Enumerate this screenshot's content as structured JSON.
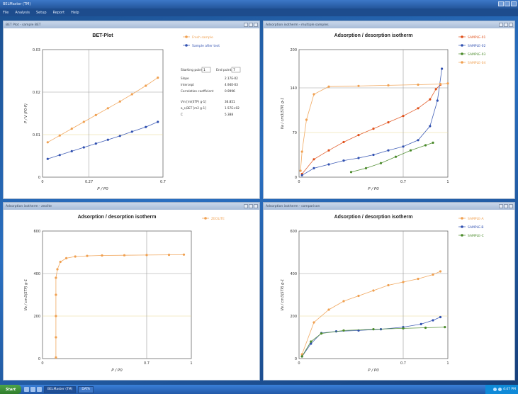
{
  "app": {
    "title": "BELMaster (TM)",
    "menu": [
      "File",
      "Analysis",
      "Setup",
      "Report",
      "Help"
    ]
  },
  "colors": {
    "orange": "#f0a050",
    "red": "#e0501a",
    "blue": "#3050b0",
    "green": "#4a8a2a",
    "lightgreen": "#8ab040",
    "ref_line": "#e8d890"
  },
  "windows": [
    {
      "id": "bet",
      "title": "BET Plot - sample BET",
      "chart_data": {
        "type": "line",
        "title": "BET-Plot",
        "xlabel": "P / P0",
        "ylabel": "P / V (P0-P)",
        "xlim": [
          0,
          0.7
        ],
        "ylim": [
          0,
          0.03
        ],
        "xticks": [
          "0",
          "0.27",
          "0.7"
        ],
        "yticks": [
          "0",
          "0.01",
          "0.02",
          "0.03"
        ],
        "series": [
          {
            "name": "Fresh sample",
            "color": "orange",
            "x": [
              0.03,
              0.1,
              0.17,
              0.24,
              0.31,
              0.38,
              0.45,
              0.52,
              0.6,
              0.67
            ],
            "y": [
              0.0082,
              0.0098,
              0.0114,
              0.013,
              0.0146,
              0.0162,
              0.0178,
              0.0195,
              0.0215,
              0.0234
            ]
          },
          {
            "name": "Sample after test",
            "color": "blue",
            "x": [
              0.03,
              0.1,
              0.17,
              0.24,
              0.31,
              0.38,
              0.45,
              0.52,
              0.6,
              0.67
            ],
            "y": [
              0.0043,
              0.0052,
              0.0061,
              0.007,
              0.0079,
              0.0088,
              0.0097,
              0.0107,
              0.0118,
              0.013
            ]
          }
        ]
      },
      "fit_panel": {
        "start_label": "Starting point",
        "end_label": "End point",
        "start_value": "1",
        "end_value": "7",
        "rows": [
          {
            "label": "Slope",
            "value": "2.17E-02"
          },
          {
            "label": "Intercept",
            "value": "4.94E-03"
          },
          {
            "label": "Correlation coefficient",
            "value": "0.9996"
          },
          {
            "label": "Vm [ml(STP) g-1]",
            "value": "36.851"
          },
          {
            "label": "a_s,BET [m2 g-1]",
            "value": "1.57E+02"
          },
          {
            "label": "C",
            "value": "5.388"
          }
        ]
      }
    },
    {
      "id": "iso1",
      "title": "Adsorption isotherm - multiple samples",
      "chart_data": {
        "type": "scatter",
        "title": "Adsorption / desorption isotherm",
        "xlabel": "P / P0",
        "ylabel": "Va / cm3(STP) g-1",
        "xlim": [
          0,
          1
        ],
        "ylim": [
          0,
          200
        ],
        "xticks": [
          "0",
          "0.7",
          "1"
        ],
        "yticks": [
          "0",
          "70",
          "140",
          "200"
        ],
        "series": [
          {
            "name": "SAMPLE-01",
            "color": "red",
            "x": [
              0.02,
              0.1,
              0.2,
              0.3,
              0.4,
              0.5,
              0.6,
              0.7,
              0.8,
              0.88,
              0.92,
              0.95
            ],
            "y": [
              5,
              28,
              42,
              55,
              66,
              76,
              86,
              96,
              108,
              122,
              138,
              145
            ]
          },
          {
            "name": "SAMPLE-02",
            "color": "blue",
            "x": [
              0.02,
              0.1,
              0.2,
              0.3,
              0.4,
              0.5,
              0.6,
              0.7,
              0.8,
              0.88,
              0.93,
              0.96
            ],
            "y": [
              3,
              14,
              20,
              26,
              30,
              35,
              42,
              48,
              58,
              80,
              120,
              170
            ]
          },
          {
            "name": "SAMPLE-03",
            "color": "green",
            "x": [
              0.35,
              0.45,
              0.55,
              0.65,
              0.75,
              0.85,
              0.9
            ],
            "y": [
              8,
              14,
              22,
              32,
              42,
              50,
              54
            ]
          },
          {
            "name": "SAMPLE-04",
            "color": "orange",
            "x": [
              0.01,
              0.02,
              0.05,
              0.1,
              0.2,
              0.4,
              0.6,
              0.8,
              0.95,
              1.0
            ],
            "y": [
              10,
              40,
              90,
              130,
              142,
              143,
              144,
              145,
              146,
              147
            ]
          }
        ]
      }
    },
    {
      "id": "iso2",
      "title": "Adsorption isotherm - zeolite",
      "chart_data": {
        "type": "scatter",
        "title": "Adsorption / desorption isotherm",
        "xlabel": "P / P0",
        "ylabel": "Va / cm3(STP) g-1",
        "xlim": [
          0,
          1
        ],
        "ylim": [
          0,
          600
        ],
        "xticks": [
          "0",
          "0.7",
          "1"
        ],
        "yticks": [
          "0",
          "200",
          "400",
          "600"
        ],
        "series": [
          {
            "name": "ZEOLITE",
            "color": "orange",
            "x": [
              0.09,
              0.09,
              0.09,
              0.09,
              0.09,
              0.1,
              0.12,
              0.16,
              0.22,
              0.3,
              0.4,
              0.55,
              0.7,
              0.85,
              0.95
            ],
            "y": [
              5,
              100,
              200,
              300,
              380,
              420,
              455,
              472,
              480,
              483,
              485,
              486,
              487,
              488,
              489
            ]
          }
        ]
      }
    },
    {
      "id": "iso3",
      "title": "Adsorption isotherm - comparison",
      "chart_data": {
        "type": "scatter",
        "title": "Adsorption / desorption isotherm",
        "xlabel": "P / P0",
        "ylabel": "Va / cm3(STP) g-1",
        "xlim": [
          0,
          1
        ],
        "ylim": [
          0,
          600
        ],
        "xticks": [
          "0",
          "0.7",
          "1"
        ],
        "yticks": [
          "0",
          "200",
          "400",
          "600"
        ],
        "series": [
          {
            "name": "SAMPLE-A",
            "color": "orange",
            "x": [
              0.02,
              0.1,
              0.2,
              0.3,
              0.4,
              0.5,
              0.6,
              0.7,
              0.8,
              0.9,
              0.95
            ],
            "y": [
              20,
              170,
              230,
              270,
              295,
              320,
              345,
              360,
              375,
              395,
              410
            ]
          },
          {
            "name": "SAMPLE-B",
            "color": "blue",
            "x": [
              0.02,
              0.08,
              0.15,
              0.25,
              0.4,
              0.55,
              0.7,
              0.82,
              0.9,
              0.95
            ],
            "y": [
              10,
              70,
              120,
              128,
              132,
              138,
              148,
              162,
              180,
              195
            ]
          },
          {
            "name": "SAMPLE-C",
            "color": "green",
            "x": [
              0.02,
              0.08,
              0.15,
              0.3,
              0.5,
              0.7,
              0.85,
              0.98
            ],
            "y": [
              10,
              80,
              118,
              132,
              138,
              142,
              145,
              148
            ]
          }
        ]
      }
    }
  ],
  "taskbar": {
    "start": "Start",
    "buttons": [
      "BELMaster (TM)",
      "DATA"
    ],
    "clock": "4:47 PM"
  }
}
